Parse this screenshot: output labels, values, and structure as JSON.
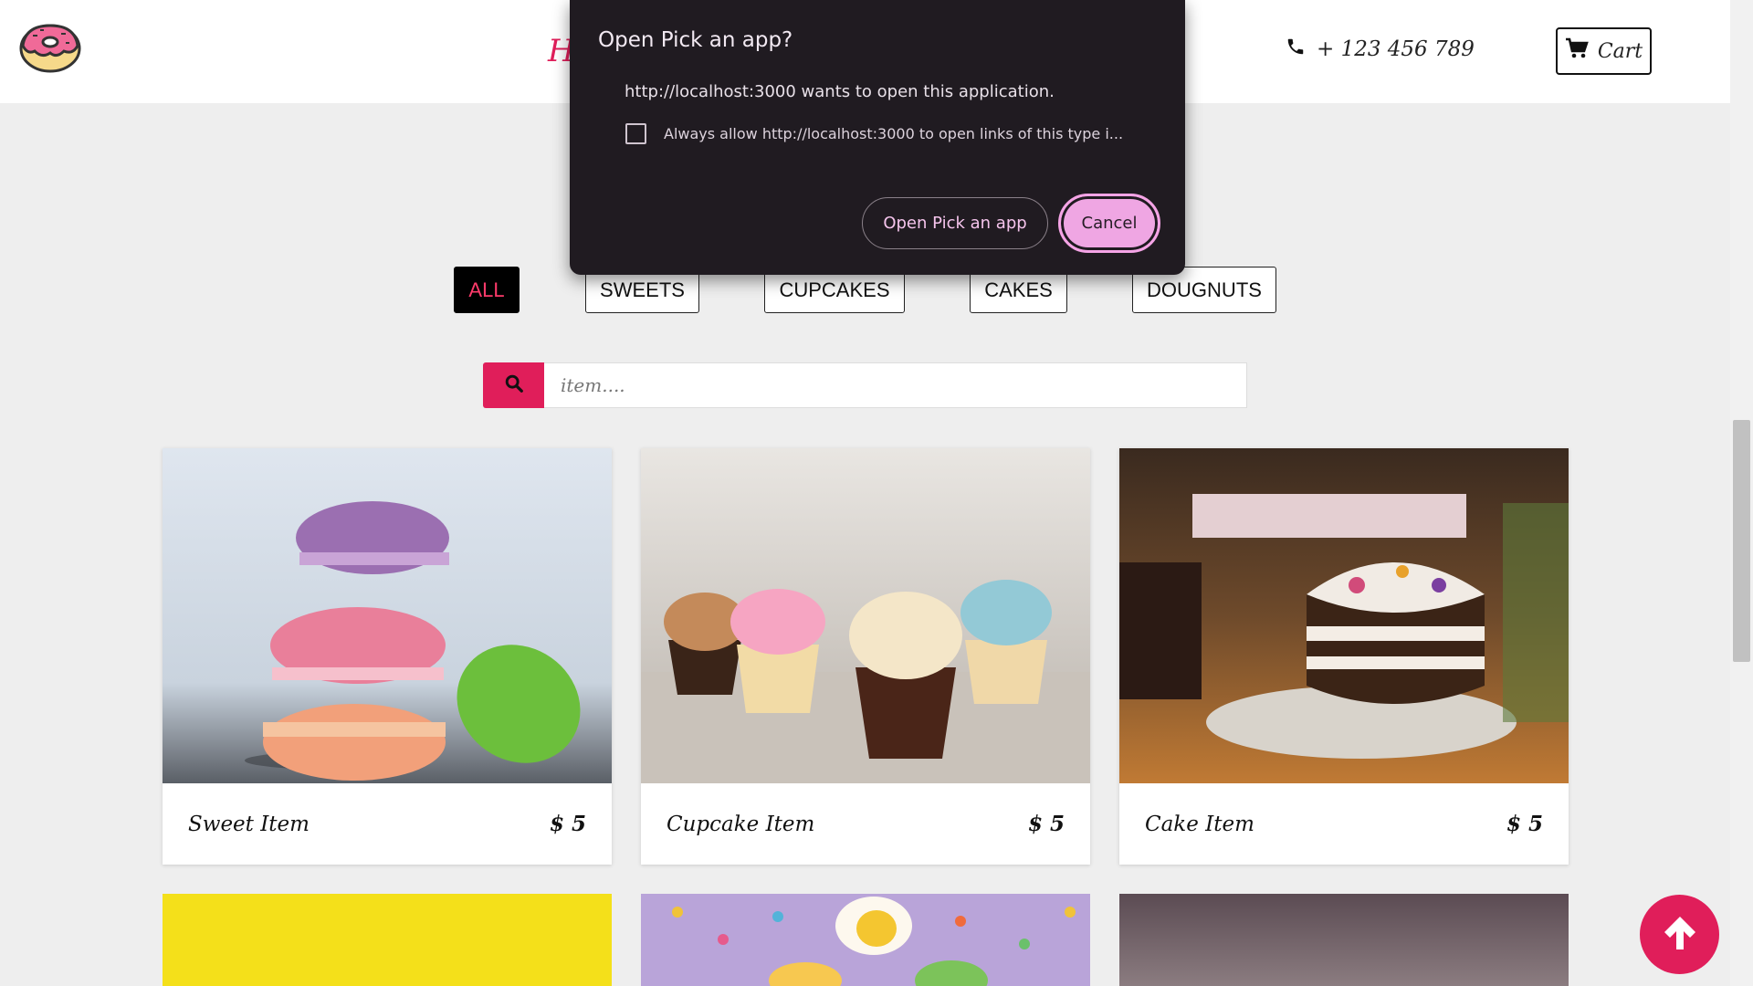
{
  "navbar": {
    "brand_partial": "H",
    "phone": "+ 123 456 789",
    "cart_label": "Cart"
  },
  "filters": {
    "items": [
      {
        "label": "ALL",
        "active": true
      },
      {
        "label": "SWEETS",
        "active": false
      },
      {
        "label": "CUPCAKES",
        "active": false
      },
      {
        "label": "CAKES",
        "active": false
      },
      {
        "label": "DOUGNUTS",
        "active": false
      }
    ]
  },
  "search": {
    "placeholder": "item...."
  },
  "items": [
    {
      "name": "Sweet Item",
      "price": "$ 5"
    },
    {
      "name": "Cupcake Item",
      "price": "$ 5"
    },
    {
      "name": "Cake Item",
      "price": "$ 5"
    }
  ],
  "dialog": {
    "title": "Open Pick an app?",
    "message": "http://localhost:3000 wants to open this application.",
    "checkbox_label": "Always allow http://localhost:3000 to open links of this type i...",
    "open_label": "Open Pick an app",
    "cancel_label": "Cancel"
  },
  "colors": {
    "accent": "#e01e5a",
    "dialog_bg": "#201b21",
    "cancel_bg": "#efa6e3"
  }
}
